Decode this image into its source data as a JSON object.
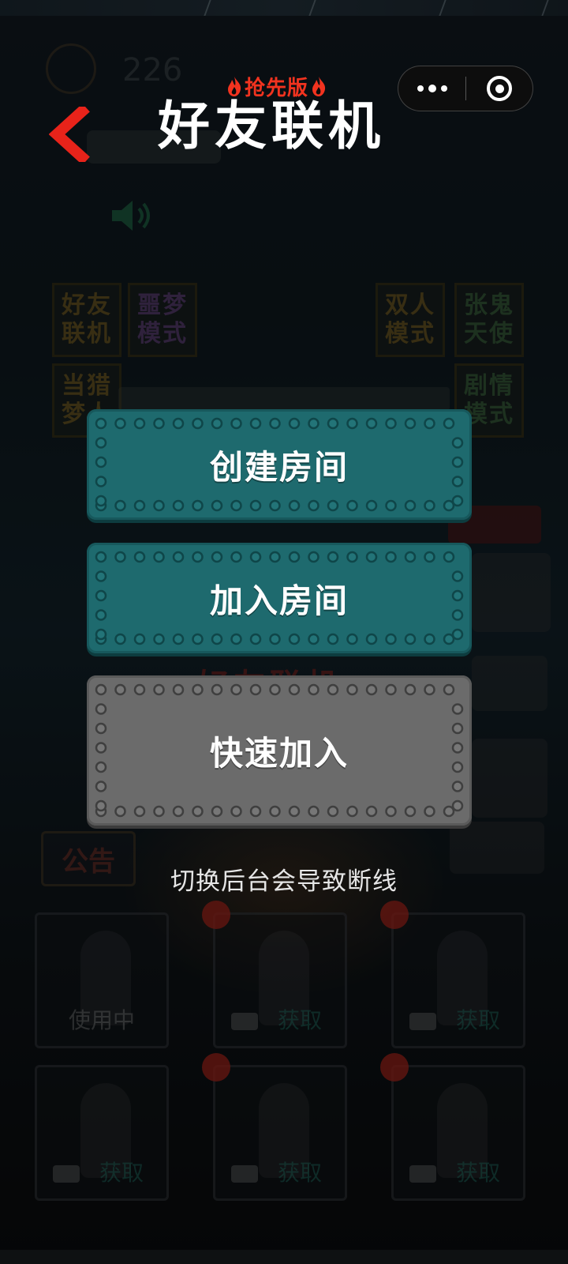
{
  "header": {
    "badge": "抢先版",
    "title": "好友联机",
    "back_icon": "chevron-left-icon",
    "capsule": {
      "more_icon": "more-dots-icon",
      "close_icon": "close-target-icon"
    }
  },
  "modal": {
    "buttons": [
      {
        "label": "创建房间",
        "style": "teal"
      },
      {
        "label": "加入房间",
        "style": "teal"
      },
      {
        "label": "快速加入",
        "style": "gray"
      }
    ],
    "hint": "切换后台会导致断线"
  },
  "background": {
    "coins": "226",
    "modes_left": [
      "好友\n联机",
      "噩梦\n模式",
      "当猎\n梦人"
    ],
    "modes_right": [
      "双人\n模式",
      "张鬼\n天使",
      "剧情\n模式"
    ],
    "banner": "好友联机",
    "announcement": "公告",
    "cards": [
      {
        "label": "使用中"
      },
      {
        "label": "获取"
      },
      {
        "label": "获取"
      },
      {
        "label": "获取"
      },
      {
        "label": "获取"
      },
      {
        "label": "获取"
      }
    ]
  },
  "colors": {
    "teal_button": "#1e6a6e",
    "gray_button": "#6b6b6b",
    "accent_red": "#e8231a",
    "badge_red": "#f2331f"
  }
}
